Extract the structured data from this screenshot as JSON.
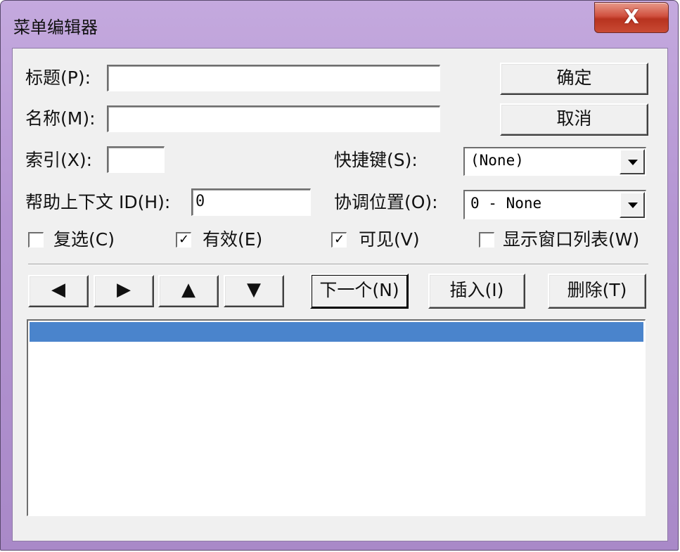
{
  "window": {
    "title": "菜单编辑器",
    "close_glyph": "X"
  },
  "fields": {
    "caption_label": "标题(P):",
    "caption_value": "",
    "name_label": "名称(M):",
    "name_value": "",
    "index_label": "索引(X):",
    "index_value": "",
    "helpid_label": "帮助上下文 ID(H):",
    "helpid_value": "0",
    "shortcut_label": "快捷键(S):",
    "shortcut_value": "(None)",
    "negotiate_label": "协调位置(O):",
    "negotiate_value": "0 - None"
  },
  "buttons": {
    "ok": "确定",
    "cancel": "取消",
    "next": "下一个(N)",
    "insert": "插入(I)",
    "delete": "删除(T)"
  },
  "checkboxes": [
    {
      "label": "复选(C)",
      "checked": false,
      "mark": ""
    },
    {
      "label": "有效(E)",
      "checked": true,
      "mark": "✓"
    },
    {
      "label": "可见(V)",
      "checked": true,
      "mark": "✓"
    },
    {
      "label": "显示窗口列表(W)",
      "checked": false,
      "mark": ""
    }
  ],
  "arrows": {
    "left": "🡐",
    "right": "🡒",
    "up": "🡑",
    "down": "🡓"
  },
  "arrow_glyphs": {
    "left": "◀",
    "right": "▶",
    "up": "▲",
    "down": "▼"
  },
  "colors": {
    "selection": "#4a84cc",
    "titlebar": "#b495d2",
    "close": "#c94a34"
  }
}
